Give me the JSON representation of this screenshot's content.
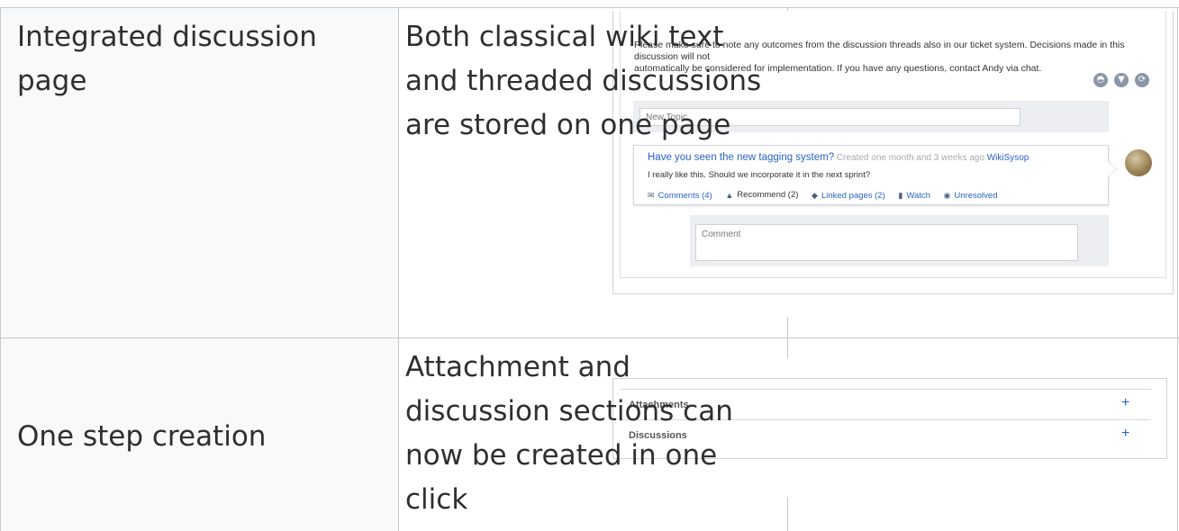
{
  "rows": [
    {
      "feature": [
        "Integrated discussion",
        "page"
      ],
      "description": [
        "Both classical wiki text",
        "and threaded discussions",
        "are stored on one page"
      ]
    },
    {
      "feature": [
        "One step creation"
      ],
      "description": [
        "Attachment and",
        "discussion sections can",
        "now be created in one",
        "click"
      ]
    }
  ],
  "discussion": {
    "notice": [
      "Please make sure to note any outcomes from the discussion threads also in our ticket system. Decisions made in this discussion will not",
      "automatically be considered for implementation. If you have any questions, contact Andy via chat."
    ],
    "toolbar_icons": [
      "chart-icon",
      "filter-icon",
      "refresh-icon"
    ],
    "new_topic_placeholder": "New Topic",
    "topic": {
      "title": "Have you seen the new tagging system?",
      "created": "Created one month and 3 weeks ago",
      "author": "WikiSysop",
      "body": "I really like this. Should we incorporate it in the next sprint?",
      "actions": {
        "comments": "Comments (4)",
        "recommend": "Recommend (2)",
        "linked": "Linked pages (2)",
        "watch": "Watch",
        "unresolved": "Unresolved"
      }
    },
    "comment_placeholder": "Comment"
  },
  "sections": {
    "attachments": "Attachments",
    "discussions": "Discussions",
    "add_symbol": "+"
  },
  "colors": {
    "link": "#2a62c9",
    "border": "#c8c8c8",
    "cell_bg": "#f8f9fa"
  }
}
